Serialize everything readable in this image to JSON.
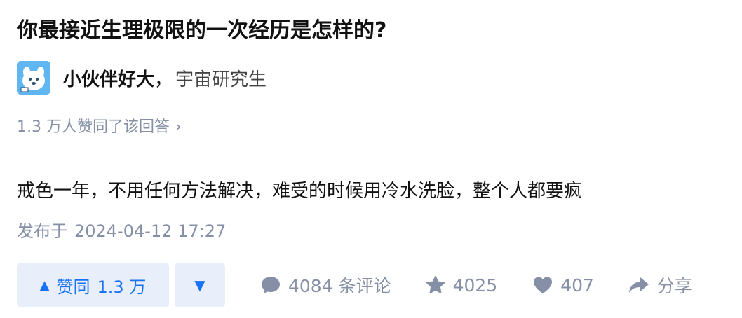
{
  "question": {
    "title": "你最接近生理极限的一次经历是怎样的?"
  },
  "author": {
    "name": "小伙伴好大",
    "separator": "，",
    "bio": "宇宙研究生"
  },
  "upvote_summary": {
    "text": "1.3 万人赞同了该回答",
    "chevron": "›"
  },
  "answer": {
    "content": "戒色一年，不用任何方法解决，难受的时候用冷水洗脸，整个人都要疯"
  },
  "publish": {
    "label": "发布于",
    "datetime": "2024-04-12 17:27"
  },
  "actions": {
    "upvote": {
      "icon": "▲",
      "label": "赞同",
      "count": "1.3 万"
    },
    "downvote": {
      "icon": "▼"
    },
    "comments": {
      "icon": "comment-icon",
      "label": "4084 条评论"
    },
    "favorite": {
      "icon": "star-icon",
      "label": "4025"
    },
    "like": {
      "icon": "heart-icon",
      "label": "407"
    },
    "share": {
      "icon": "share-arrow-icon",
      "label": "分享"
    }
  },
  "colors": {
    "primary": "#1772f6",
    "button_bg": "#e8effb",
    "meta_gray": "#8590a6",
    "text": "#121212"
  }
}
